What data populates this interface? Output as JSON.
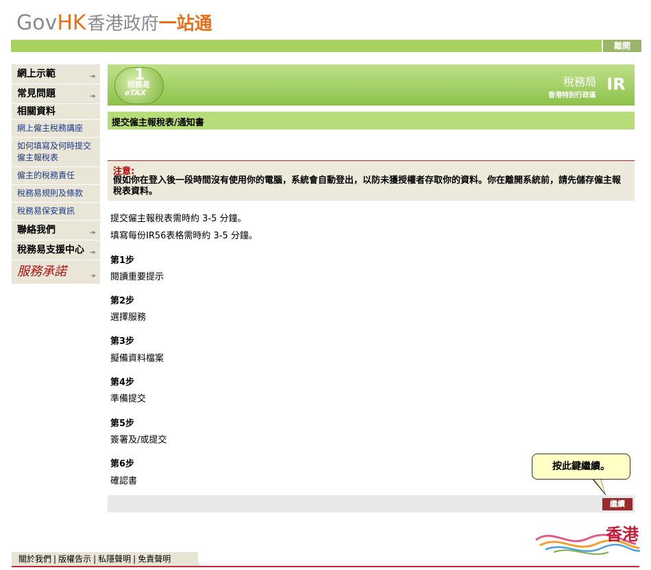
{
  "header": {
    "logo_gov": "Gov",
    "logo_hk": "HK",
    "logo_cn1": "香港政府",
    "logo_cn2": "一站通",
    "logout_label": "離開"
  },
  "sidebar": {
    "items": [
      {
        "label": "網上示範",
        "type": "main"
      },
      {
        "label": "常見問題",
        "type": "main"
      },
      {
        "label": "相關資料",
        "type": "head"
      },
      {
        "label": "網上僱主稅務講座",
        "type": "sub"
      },
      {
        "label": "如何填寫及何時提交僱主報稅表",
        "type": "sub"
      },
      {
        "label": "僱主的稅務責任",
        "type": "sub"
      },
      {
        "label": "稅務易規則及條款",
        "type": "sub"
      },
      {
        "label": "稅務易保安資訊",
        "type": "sub"
      },
      {
        "label": "聯絡我們",
        "type": "main"
      },
      {
        "label": "稅務易支援中心",
        "type": "main"
      },
      {
        "label": "服務承諾",
        "type": "service"
      }
    ]
  },
  "banner": {
    "etax_cn": "稅務易",
    "etax_en": "eTAX",
    "etax_one": "1",
    "ird_name": "稅務局",
    "ird_region": "香港特別行政區",
    "ird_logo": "IR"
  },
  "page": {
    "title": "提交僱主報稅表/通知書",
    "notice_label": "注意:",
    "notice_text": "假如你在登入後一段時間沒有使用你的電腦，系統會自動登出，以防未獲授權者存取你的資料。你在離開系統前，請先儲存僱主報稅表資料。",
    "info1": "提交僱主報稅表需時約 3-5 分鐘。",
    "info2": "填寫每份IR56表格需時約 3-5 分鐘。",
    "steps": [
      {
        "title": "第1步",
        "desc": "閱讀重要提示"
      },
      {
        "title": "第2步",
        "desc": "選擇服務"
      },
      {
        "title": "第3步",
        "desc": "擬備資料檔案"
      },
      {
        "title": "第4步",
        "desc": "準備提交"
      },
      {
        "title": "第5步",
        "desc": "簽署及/或提交"
      },
      {
        "title": "第6步",
        "desc": "確認書"
      }
    ],
    "tooltip": "按此鍵繼續。",
    "continue_label": "繼續"
  },
  "footer": {
    "links": [
      "關於我們",
      "版權告示",
      "私隱聲明",
      "免責聲明"
    ],
    "brand": "香港"
  },
  "colors": {
    "green": "#a8d160",
    "title_green": "#b8dc78",
    "sidebar_bg": "#e9e6d8",
    "accent_red": "#9b2b2b"
  }
}
